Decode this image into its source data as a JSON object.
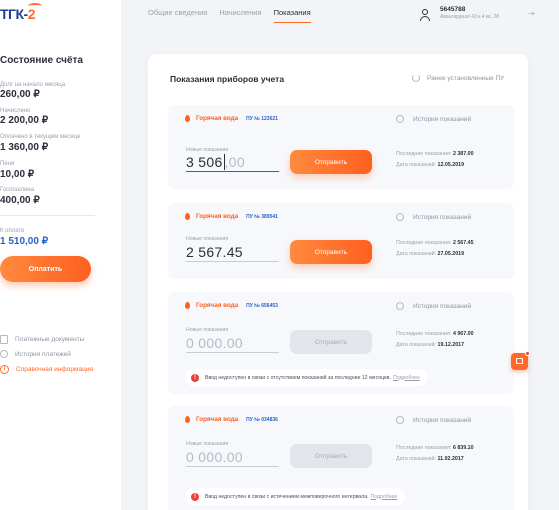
{
  "logo": {
    "text": "ТГК-",
    "suffix": "2"
  },
  "account": {
    "title": "Состояние счёта",
    "items": [
      {
        "label": "Долг на начало месяца",
        "value": "260,00 ₽"
      },
      {
        "label": "Начислено",
        "value": "2 200,00 ₽"
      },
      {
        "label": "Оплачено в текущем месяце",
        "value": "1 360,00 ₽"
      },
      {
        "label": "Пени",
        "value": "10,00 ₽"
      },
      {
        "label": "Госпошлина",
        "value": "400,00 ₽"
      }
    ],
    "to_pay_label": "К оплате",
    "to_pay_value": "1 510,00 ₽",
    "pay_button": "Оплатить"
  },
  "side_links": [
    {
      "label": "Платежные документы",
      "icon": "document-icon"
    },
    {
      "label": "История платежей",
      "icon": "clock-icon"
    },
    {
      "label": "Справочная информация",
      "icon": "info-icon"
    }
  ],
  "nav": {
    "tabs": [
      "Общие сведения",
      "Начисления",
      "Показания"
    ],
    "active": "Показания"
  },
  "user": {
    "account": "5645788",
    "address": "Авангардная 43 к.4 кв. 28"
  },
  "panel": {
    "title": "Показания приборов учета",
    "prev_link": "Ранее установленные ПУ"
  },
  "cards": [
    {
      "type": "Горячая вода",
      "pu": "ПУ № 123621",
      "history": "История показаний",
      "new_label": "Новые показания",
      "reading": "3 506",
      "reading_faded": ",00",
      "button": "Отправить",
      "last_label": "Последние показания:",
      "last_value": "2 387.00",
      "date_label": "Дата показаний:",
      "date_value": "12.05.2019"
    },
    {
      "type": "Горячая вода",
      "pu": "ПУ № 389541",
      "history": "История показаний",
      "new_label": "Новые показания",
      "reading": "2 567.45",
      "button": "Отправить",
      "last_label": "Последние показания:",
      "last_value": "2 567.45",
      "date_label": "Дата показаний:",
      "date_value": "27.05.2019"
    },
    {
      "type": "Горячая вода",
      "pu": "ПУ № 656453",
      "history": "История показаний",
      "new_label": "Новые показания",
      "placeholder": "0 000.00",
      "button": "Отправить",
      "last_label": "Последние показания:",
      "last_value": "4 967.00",
      "date_label": "Дата показаний:",
      "date_value": "19.12.2017",
      "warning": "Ввод недоступен в связи с отсутствием показаний за последние 12 месяцев.",
      "warning_link": "Подробнее"
    },
    {
      "type": "Горячая вода",
      "pu": "ПУ № 034836",
      "history": "История показаний",
      "new_label": "Новые показания",
      "placeholder": "0 000.00",
      "button": "Отправить",
      "last_label": "Последние показания:",
      "last_value": "6 839.10",
      "date_label": "Дата показаний:",
      "date_value": "11.02.2017",
      "warning": "Ввод недоступен в связи с истечением межповерочного интервала.",
      "warning_link": "Подробнее"
    }
  ],
  "colors": {
    "accent": "#ff6a28",
    "link": "#2a61c7",
    "error": "#e8423b"
  }
}
